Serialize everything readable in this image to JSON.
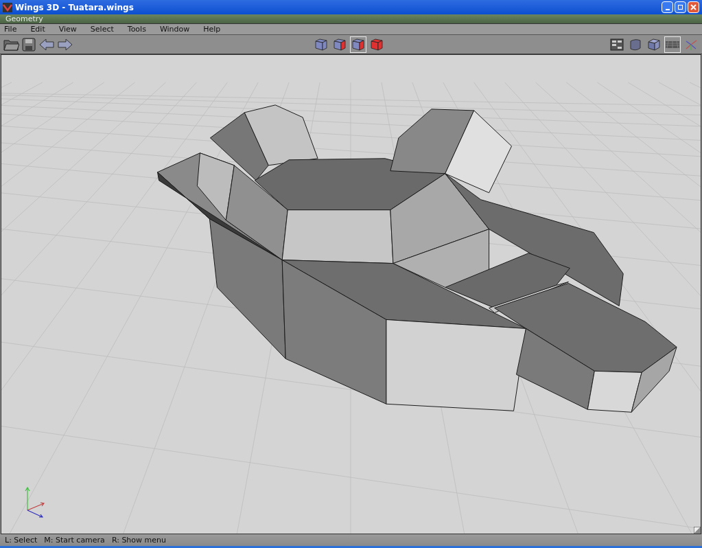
{
  "window": {
    "title": "Wings 3D - Tuatara.wings"
  },
  "geometry_window": {
    "title": "Geometry"
  },
  "menu": [
    "File",
    "Edit",
    "View",
    "Select",
    "Tools",
    "Window",
    "Help"
  ],
  "selection_modes": [
    {
      "kind": "vertex",
      "selected": false
    },
    {
      "kind": "edge",
      "selected": false
    },
    {
      "kind": "face",
      "selected": true
    },
    {
      "kind": "body",
      "selected": false
    }
  ],
  "view_buttons": [
    {
      "kind": "outliner",
      "selected": false
    },
    {
      "kind": "smooth",
      "selected": false
    },
    {
      "kind": "flat",
      "selected": false
    },
    {
      "kind": "groundplane",
      "selected": true
    },
    {
      "kind": "axes",
      "selected": false
    }
  ],
  "status_bar": [
    "L: Select",
    "M: Start camera",
    "R: Show menu"
  ]
}
